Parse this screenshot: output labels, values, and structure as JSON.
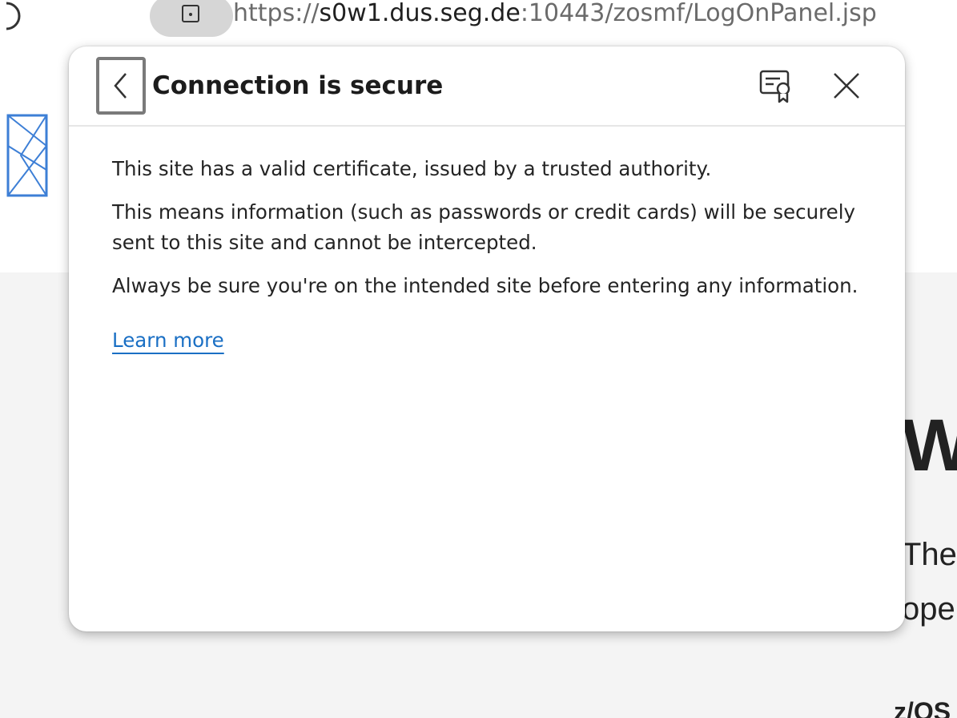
{
  "address_bar": {
    "url_scheme": "https://",
    "url_host": "s0w1.dus.seg.de",
    "url_path": ":10443/zosmf/LogOnPanel.jsp"
  },
  "flyout": {
    "title": "Connection is secure",
    "paragraphs": [
      "This site has a valid certificate, issued by a trusted authority.",
      "This means information (such as passwords or credit cards) will be securely sent to this site and cannot be intercepted.",
      "Always be sure you're on the intended site before entering any information."
    ],
    "learn_more_label": "Learn more",
    "icons": {
      "back": "chevron-left-icon",
      "certificate": "certificate-icon",
      "close": "close-icon"
    }
  },
  "background_page": {
    "heading_fragment": "W",
    "text_fragment_1": "The",
    "text_fragment_2": "ope",
    "text_fragment_3": "z/OS"
  },
  "colors": {
    "link": "#1a6fc4",
    "site_info_pill": "#d6d6d6",
    "focus_outline": "#7a7a7a"
  }
}
